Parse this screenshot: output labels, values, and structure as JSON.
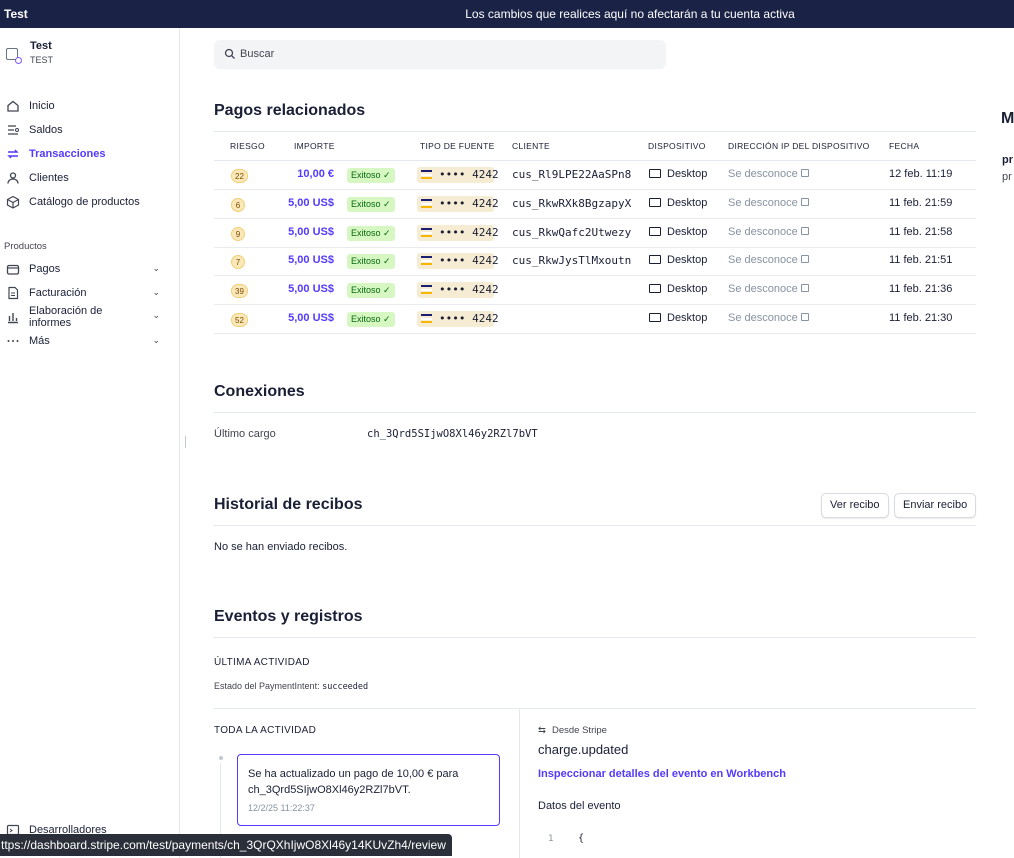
{
  "banner": {
    "account": "Test",
    "message": "Los cambios que realices aquí no afectarán a tu cuenta activa"
  },
  "sidebar": {
    "account_name": "Test",
    "account_sub": "TEST",
    "items": [
      {
        "label": "Inicio",
        "icon": "home-icon"
      },
      {
        "label": "Saldos",
        "icon": "balance-icon"
      },
      {
        "label": "Transacciones",
        "icon": "transfer-icon",
        "active": true
      },
      {
        "label": "Clientes",
        "icon": "person-icon"
      },
      {
        "label": "Catálogo de productos",
        "icon": "box-icon"
      }
    ],
    "section_label": "Productos",
    "product_items": [
      {
        "label": "Pagos",
        "icon": "wallet-icon"
      },
      {
        "label": "Facturación",
        "icon": "invoice-icon"
      },
      {
        "label_line1": "Elaboración de",
        "label_line2": "informes",
        "icon": "bar-chart-icon"
      },
      {
        "label": "Más",
        "icon": "more-icon"
      }
    ],
    "bottom_item": "Desarrolladores"
  },
  "search": {
    "placeholder": "Buscar"
  },
  "related": {
    "title": "Pagos relacionados",
    "headers": {
      "risk": "RIESGO",
      "amount": "IMPORTE",
      "source": "TIPO DE FUENTE",
      "customer": "CLIENTE",
      "device": "DISPOSITIVO",
      "ip": "DIRECCIÓN IP DEL DISPOSITIVO",
      "date": "FECHA"
    },
    "rows": [
      {
        "risk": "22",
        "amount": "10,00 €",
        "status": "Exitoso ✓",
        "card": "•••• 4242",
        "customer": "cus_Rl9LPE22AaSPn8",
        "device": "Desktop",
        "ip": "Se desconoce",
        "date": "12 feb. 11:19"
      },
      {
        "risk": "6",
        "amount": "5,00 US$",
        "status": "Exitoso ✓",
        "card": "•••• 4242",
        "customer": "cus_RkwRXk8BgzapyX",
        "device": "Desktop",
        "ip": "Se desconoce",
        "date": "11 feb. 21:59"
      },
      {
        "risk": "9",
        "amount": "5,00 US$",
        "status": "Exitoso ✓",
        "card": "•••• 4242",
        "customer": "cus_RkwQafc2Utwezy",
        "device": "Desktop",
        "ip": "Se desconoce",
        "date": "11 feb. 21:58"
      },
      {
        "risk": "7",
        "amount": "5,00 US$",
        "status": "Exitoso ✓",
        "card": "•••• 4242",
        "customer": "cus_RkwJysTlMxoutn",
        "device": "Desktop",
        "ip": "Se desconoce",
        "date": "11 feb. 21:51"
      },
      {
        "risk": "39",
        "amount": "5,00 US$",
        "status": "Exitoso ✓",
        "card": "•••• 4242",
        "customer": "",
        "device": "Desktop",
        "ip": "Se desconoce",
        "date": "11 feb. 21:36"
      },
      {
        "risk": "52",
        "amount": "5,00 US$",
        "status": "Exitoso ✓",
        "card": "•••• 4242",
        "customer": "",
        "device": "Desktop",
        "ip": "Se desconoce",
        "date": "11 feb. 21:30"
      }
    ]
  },
  "connections": {
    "title": "Conexiones",
    "last_charge_label": "Último cargo",
    "last_charge_value": "ch_3Qrd5SIjwO8Xl46y2RZl7bVT"
  },
  "receipts": {
    "title": "Historial de recibos",
    "view_button": "Ver recibo",
    "send_button": "Enviar recibo",
    "empty_text": "No se han enviado recibos."
  },
  "events": {
    "title": "Eventos y registros",
    "last_activity_label": "ÚLTIMA ACTIVIDAD",
    "pi_status_label": "Estado del PaymentIntent:",
    "pi_status_value": "succeeded",
    "all_activity_label": "TODA LA ACTIVIDAD",
    "activity_text": "Se ha actualizado un pago de 10,00 € para ch_3Qrd5SIjwO8Xl46y2RZl7bVT.",
    "activity_time": "12/2/25 11:22:37",
    "source_label": "Desde Stripe",
    "event_name": "charge.updated",
    "inspect_link": "Inspeccionar detalles del evento en Workbench",
    "event_data_label": "Datos del evento",
    "code_line_no": "1",
    "code_line": "{"
  },
  "right_edge": {
    "heading": "M",
    "line1": "pr",
    "line2": "pr"
  },
  "status_bar": {
    "url": "ttps://dashboard.stripe.com/test/payments/ch_3QrQXhIjwO8Xl46y14KUvZh4/review"
  },
  "colors": {
    "accent": "#533afd",
    "banner": "#1a2246",
    "success_bg": "#d7f7c2"
  }
}
